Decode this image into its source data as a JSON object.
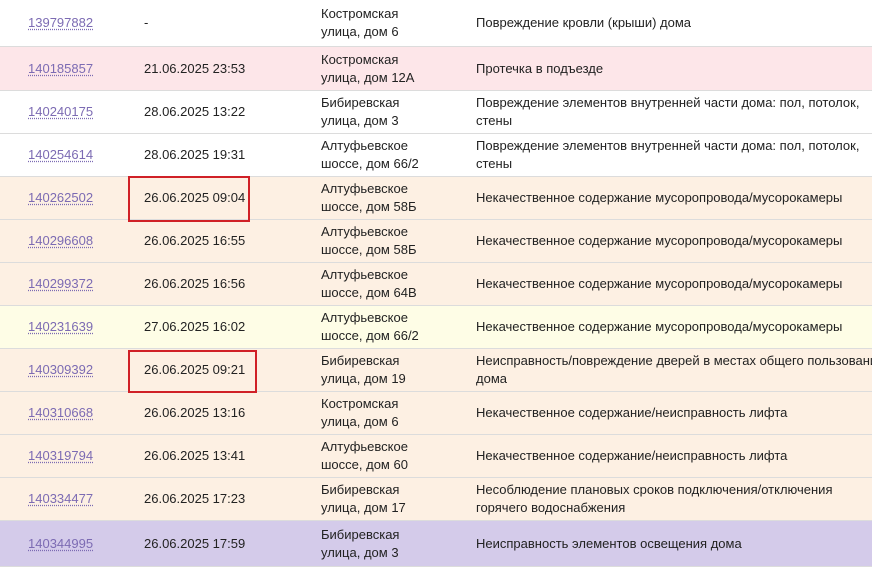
{
  "rows": [
    {
      "id": "139797882",
      "date": "-",
      "addr1": "Костромская",
      "addr2": "улица, дом 6",
      "desc": "Повреждение кровли (крыши) дома"
    },
    {
      "id": "140185857",
      "date": "21.06.2025 23:53",
      "addr1": "Костромская",
      "addr2": "улица, дом 12А",
      "desc": "Протечка в подъезде"
    },
    {
      "id": "140240175",
      "date": "28.06.2025 13:22",
      "addr1": "Бибиревская",
      "addr2": "улица, дом 3",
      "desc": "Повреждение элементов внутренней части дома: пол, потолок, стены"
    },
    {
      "id": "140254614",
      "date": "28.06.2025 19:31",
      "addr1": "Алтуфьевское",
      "addr2": "шоссе, дом 66/2",
      "desc": "Повреждение элементов внутренней части дома: пол, потолок, стены"
    },
    {
      "id": "140262502",
      "date": "26.06.2025 09:04",
      "addr1": "Алтуфьевское",
      "addr2": "шоссе, дом 58Б",
      "desc": "Некачественное содержание мусоропровода/мусорокамеры"
    },
    {
      "id": "140296608",
      "date": "26.06.2025 16:55",
      "addr1": "Алтуфьевское",
      "addr2": "шоссе, дом 58Б",
      "desc": "Некачественное содержание мусоропровода/мусорокамеры"
    },
    {
      "id": "140299372",
      "date": "26.06.2025 16:56",
      "addr1": "Алтуфьевское",
      "addr2": "шоссе, дом 64В",
      "desc": "Некачественное содержание мусоропровода/мусорокамеры"
    },
    {
      "id": "140231639",
      "date": "27.06.2025 16:02",
      "addr1": "Алтуфьевское",
      "addr2": "шоссе, дом 66/2",
      "desc": "Некачественное содержание мусоропровода/мусорокамеры"
    },
    {
      "id": "140309392",
      "date": "26.06.2025 09:21",
      "addr1": "Бибиревская",
      "addr2": "улица, дом 19",
      "desc": "Неисправность/повреждение дверей в местах общего пользования дома"
    },
    {
      "id": "140310668",
      "date": "26.06.2025 13:16",
      "addr1": "Костромская",
      "addr2": "улица, дом 6",
      "desc": "Некачественное содержание/неисправность лифта"
    },
    {
      "id": "140319794",
      "date": "26.06.2025 13:41",
      "addr1": "Алтуфьевское",
      "addr2": "шоссе, дом 60",
      "desc": "Некачественное содержание/неисправность лифта"
    },
    {
      "id": "140334477",
      "date": "26.06.2025 17:23",
      "addr1": "Бибиревская",
      "addr2": "улица, дом 17",
      "desc": "Несоблюдение плановых сроков подключения/отключения горячего водоснабжения"
    },
    {
      "id": "140344995",
      "date": "26.06.2025 17:59",
      "addr1": "Бибиревская",
      "addr2": "улица, дом 3",
      "desc": "Неисправность элементов освещения дома"
    }
  ],
  "colors": {
    "white": "#ffffff",
    "pink": "#fde6e9",
    "peach": "#fdf0e3",
    "yellow": "#fefde6",
    "purple": "#d4cbea",
    "link": "#7c6bb3",
    "highlight_border": "#d02027"
  }
}
